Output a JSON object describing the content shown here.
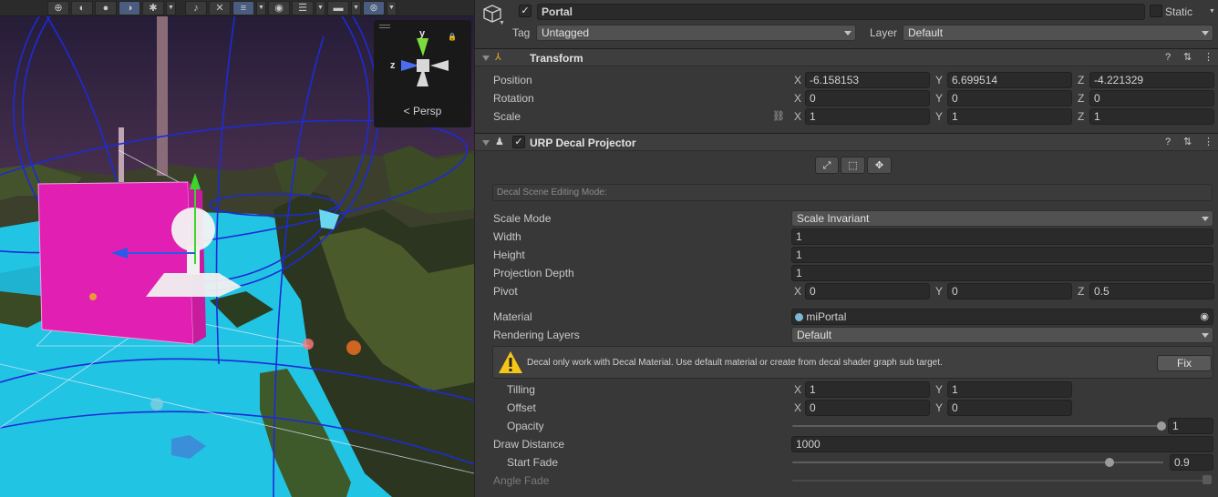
{
  "scene": {
    "toolbar_icons": [
      "grid-icon",
      "shading-icon",
      "solid-sphere-icon",
      "half-sphere-icon",
      "bug-icon",
      "audio-mute-icon",
      "effects-off-icon",
      "layers-icon",
      "visibility-icon",
      "stack-icon",
      "camera-icon",
      "gizmo-icon"
    ],
    "persp_label": "Persp",
    "gizmo_axes": {
      "y": "y",
      "z": "z"
    },
    "colors": {
      "sky_top": "#2a2140",
      "sky_bottom": "#a65e6e",
      "water": "#22c7e6",
      "portal": "#e21fb3",
      "foliage": "#2f3a22"
    }
  },
  "inspector": {
    "object": {
      "name": "Portal",
      "active": true,
      "static_label": "Static",
      "tag_label": "Tag",
      "tag_value": "Untagged",
      "layer_label": "Layer",
      "layer_value": "Default"
    },
    "transform": {
      "title": "Transform",
      "position_label": "Position",
      "rotation_label": "Rotation",
      "scale_label": "Scale",
      "position": {
        "x": "-6.158153",
        "y": "6.699514",
        "z": "-4.221329"
      },
      "rotation": {
        "x": "0",
        "y": "0",
        "z": "0"
      },
      "scale": {
        "x": "1",
        "y": "1",
        "z": "1"
      }
    },
    "decal": {
      "title": "URP Decal Projector",
      "enabled": true,
      "editing_mode_label": "Decal Scene Editing Mode:",
      "scale_mode_label": "Scale Mode",
      "scale_mode_value": "Scale Invariant",
      "width_label": "Width",
      "width_value": "1",
      "height_label": "Height",
      "height_value": "1",
      "projection_depth_label": "Projection Depth",
      "projection_depth_value": "1",
      "pivot_label": "Pivot",
      "pivot": {
        "x": "0",
        "y": "0",
        "z": "0.5"
      },
      "material_label": "Material",
      "material_value": "miPortal",
      "rendering_layers_label": "Rendering Layers",
      "rendering_layers_value": "Default",
      "warning_text": "Decal only work with Decal Material. Use default material or create from decal shader graph sub target.",
      "fix_label": "Fix",
      "tilling_label": "Tilling",
      "tilling": {
        "x": "1",
        "y": "1"
      },
      "offset_label": "Offset",
      "offset": {
        "x": "0",
        "y": "0"
      },
      "opacity_label": "Opacity",
      "opacity_value": "1",
      "opacity_fraction": 1.0,
      "draw_distance_label": "Draw Distance",
      "draw_distance_value": "1000",
      "start_fade_label": "Start Fade",
      "start_fade_value": "0.9",
      "start_fade_fraction": 0.9,
      "angle_fade_label": "Angle Fade"
    },
    "axis_labels": {
      "x": "X",
      "y": "Y",
      "z": "Z"
    },
    "colors": {
      "panel": "#383838",
      "field": "#2a2a2a",
      "header": "#3e3e3e",
      "warning": "#f5c518"
    }
  }
}
